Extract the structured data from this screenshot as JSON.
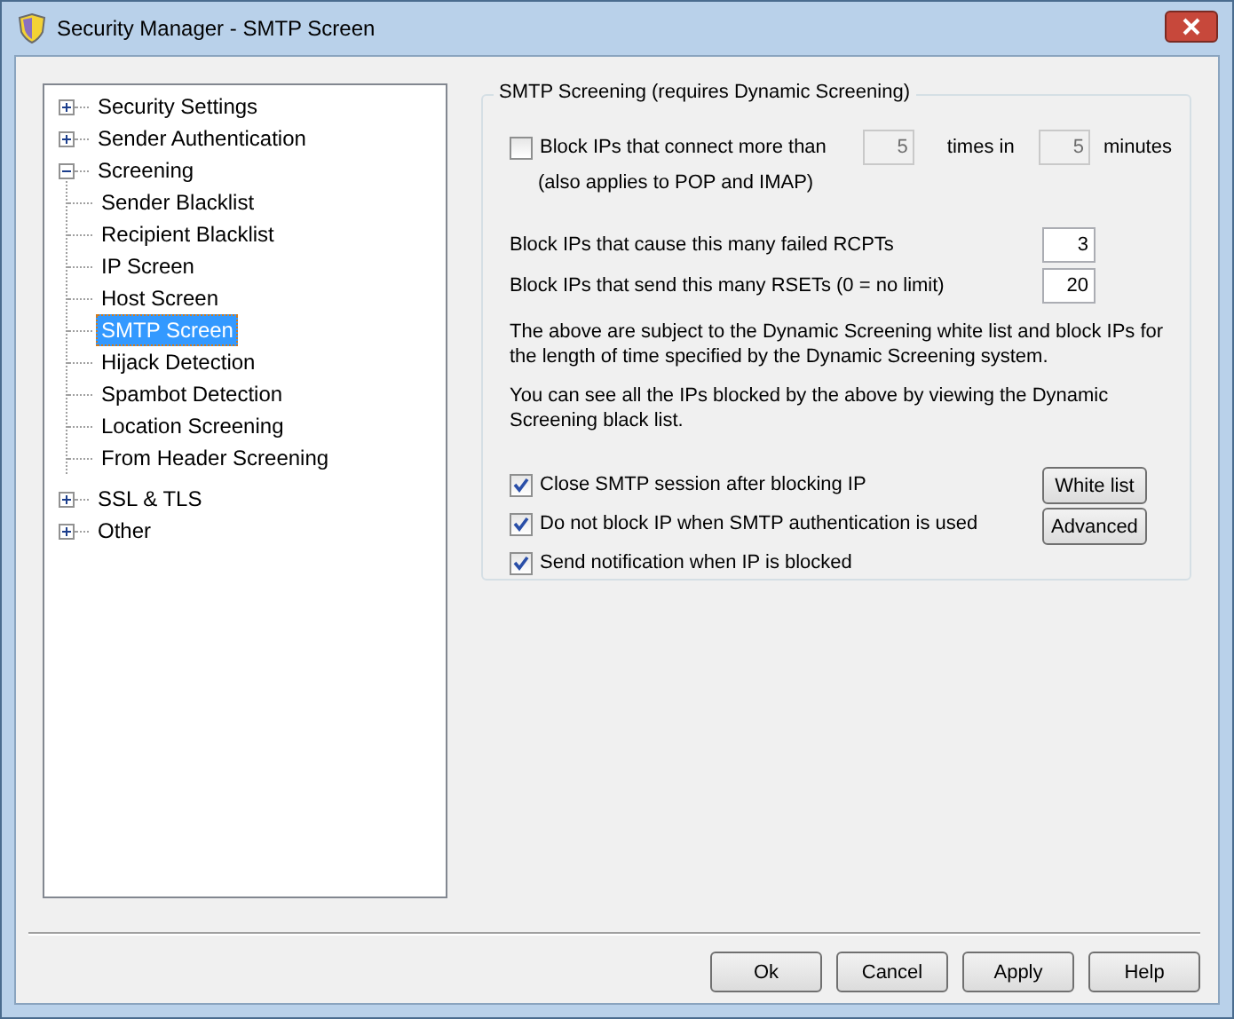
{
  "window": {
    "title": "Security Manager - SMTP Screen"
  },
  "tree": [
    {
      "label": "Security Settings",
      "expanded": false,
      "selected": false
    },
    {
      "label": "Sender Authentication",
      "expanded": false,
      "selected": false
    },
    {
      "label": "Screening",
      "expanded": true,
      "selected": false,
      "children": [
        {
          "label": "Sender Blacklist",
          "selected": false
        },
        {
          "label": "Recipient Blacklist",
          "selected": false
        },
        {
          "label": "IP Screen",
          "selected": false
        },
        {
          "label": "Host Screen",
          "selected": false
        },
        {
          "label": "SMTP Screen",
          "selected": true
        },
        {
          "label": "Hijack Detection",
          "selected": false
        },
        {
          "label": "Spambot Detection",
          "selected": false
        },
        {
          "label": "Location Screening",
          "selected": false
        },
        {
          "label": "From Header Screening",
          "selected": false
        }
      ]
    },
    {
      "label": "SSL & TLS",
      "expanded": false,
      "selected": false
    },
    {
      "label": "Other",
      "expanded": false,
      "selected": false
    }
  ],
  "group": {
    "title": "SMTP Screening (requires Dynamic Screening)",
    "connect": {
      "checked": false,
      "label": "Block IPs that connect more than",
      "times": "5",
      "times_label": "times in",
      "minutes": "5",
      "minutes_label": "minutes",
      "note": "(also applies to POP and IMAP)"
    },
    "limits": [
      {
        "label": "Block IPs that cause this many failed RCPTs",
        "value": "3"
      },
      {
        "label": "Block IPs that send this many RSETs (0 = no limit)",
        "value": "20"
      }
    ],
    "paragraphs": [
      "The above are subject to the Dynamic Screening white list and block IPs for the length of time specified by the Dynamic Screening system.",
      "You can see all the IPs blocked by the above by viewing the Dynamic Screening black list."
    ],
    "options": [
      {
        "label": "Close SMTP session after blocking IP",
        "checked": true
      },
      {
        "label": "Do not block IP when SMTP authentication is used",
        "checked": true
      },
      {
        "label": "Send notification when IP is blocked",
        "checked": true
      }
    ],
    "side_buttons": [
      "White list",
      "Advanced"
    ]
  },
  "buttons": [
    "Ok",
    "Cancel",
    "Apply",
    "Help"
  ]
}
